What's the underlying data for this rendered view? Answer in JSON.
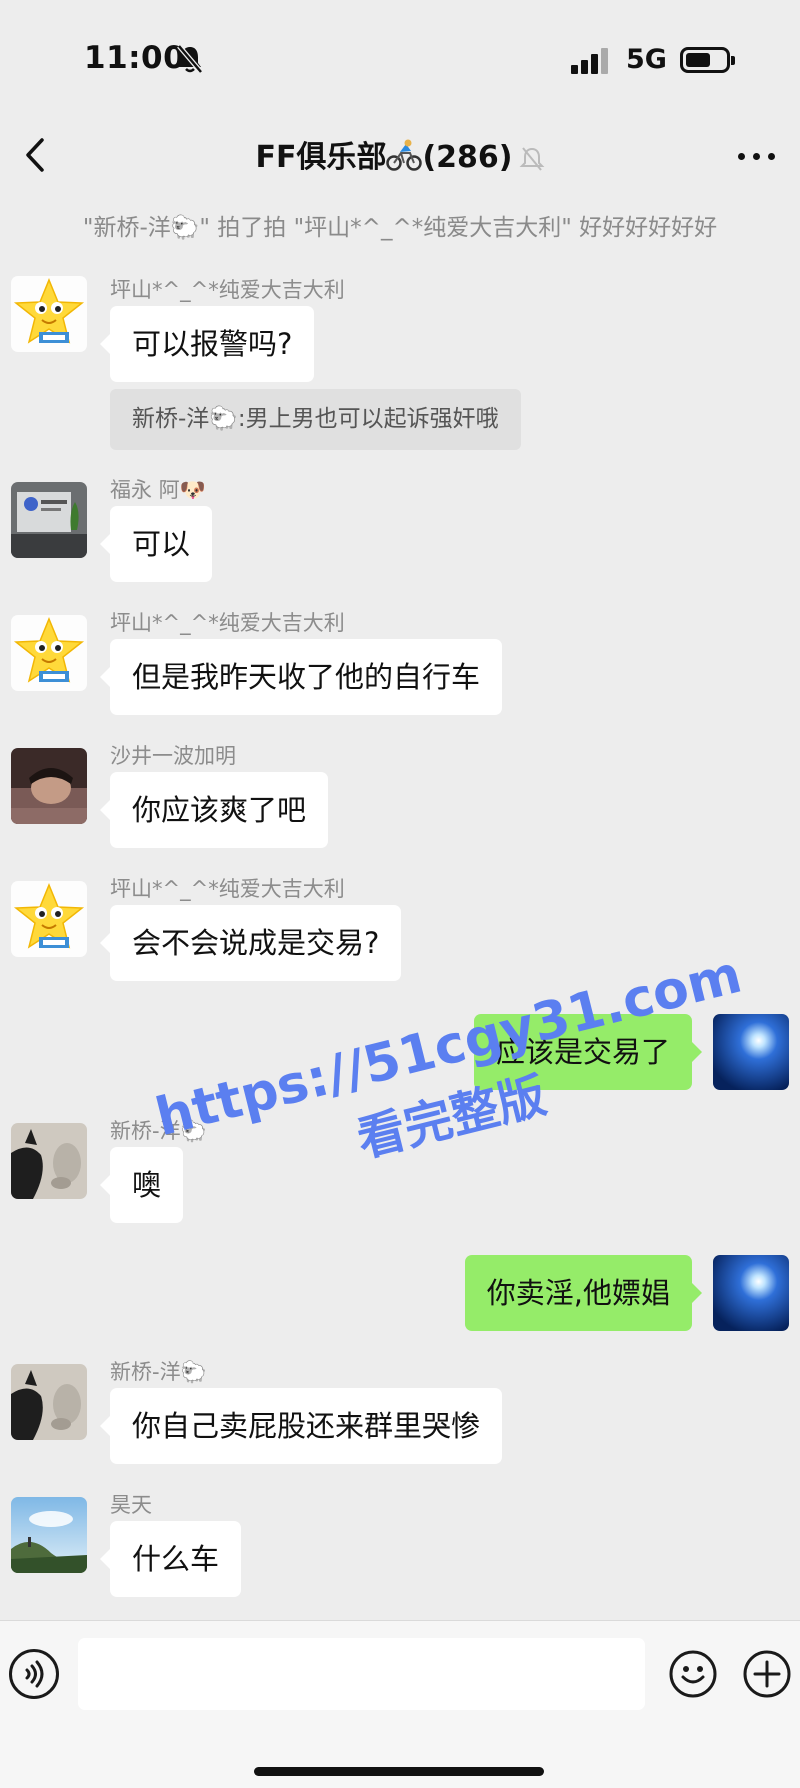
{
  "status_bar": {
    "time": "11:00",
    "network": "5G",
    "icons": [
      "bell-slash-icon",
      "signal-bars-icon",
      "battery-icon"
    ]
  },
  "nav": {
    "title": "FF俱乐部",
    "title_emoji": "bike-rider-icon",
    "member_count": "(286)",
    "muted": true
  },
  "system_msg": "\"新桥-洋🐑\" 拍了拍 \"坪山*^_^*纯爱大吉大利\" 好好好好好好",
  "messages": [
    {
      "side": "left",
      "sender": "坪山*^_^*纯爱大吉大利",
      "text": "可以报警吗?",
      "avatar": "star-mascot"
    },
    {
      "side": "left",
      "sender": "福永 阿🐶",
      "text": "可以",
      "avatar": "office-photo"
    },
    {
      "side": "left",
      "sender": "坪山*^_^*纯爱大吉大利",
      "text": "但是我昨天收了他的自行车",
      "avatar": "star-mascot"
    },
    {
      "side": "left",
      "sender": "沙井一波加明",
      "text": "你应该爽了吧",
      "avatar": "person-photo"
    },
    {
      "side": "left",
      "sender": "坪山*^_^*纯爱大吉大利",
      "text": "会不会说成是交易?",
      "avatar": "star-mascot"
    },
    {
      "side": "right",
      "text": "应该是交易了",
      "avatar": "blue-sun"
    },
    {
      "side": "left",
      "sender": "新桥-洋🐑",
      "text": "噢",
      "avatar": "cat-photo"
    },
    {
      "side": "right",
      "text": "你卖淫,他嫖娼",
      "avatar": "blue-sun"
    },
    {
      "side": "left",
      "sender": "新桥-洋🐑",
      "text": "你自己卖屁股还来群里哭惨",
      "avatar": "cat-photo"
    },
    {
      "side": "left",
      "sender": "昊天",
      "text": "什么车",
      "avatar": "landscape-photo"
    }
  ],
  "quote": "新桥-洋🐑:男上男也可以起诉强奸哦",
  "watermark": {
    "url": "https://51cgy31.com",
    "subtitle": "看完整版"
  },
  "input": {
    "value": ""
  },
  "colors": {
    "background": "#ededed",
    "bubble_in": "#ffffff",
    "bubble_out": "#95ec69",
    "watermark": "#5b7ff0"
  }
}
